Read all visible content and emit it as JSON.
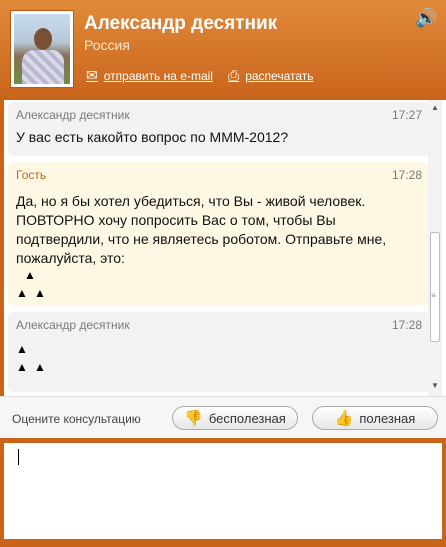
{
  "header": {
    "name": "Александр десятник",
    "country": "Россия",
    "email_label": "отправить на e-mail",
    "print_label": "распечатать",
    "icons": {
      "speaker": "speaker-icon",
      "email": "envelope-icon",
      "print": "printer-icon"
    }
  },
  "messages": [
    {
      "sender": "Александр десятник",
      "time": "17:27",
      "text": "У вас есть какойто вопрос по МММ-2012?"
    },
    {
      "sender": "Гость",
      "time": "17:28",
      "lines": [
        "Да, но я бы хотел убедиться, что Вы - живой человек.",
        "ПОВТОРНО хочу попросить Вас о том, чтобы Вы",
        "подтвердили, что не являетесь роботом. Отправьте мне,",
        "пожалуйста, это:"
      ]
    },
    {
      "sender": "Александр десятник",
      "time": "17:28"
    }
  ],
  "triangle_glyph": "▲",
  "rating": {
    "label": "Оцените консультацию",
    "useless_label": "бесполезная",
    "useful_label": "полезная"
  },
  "colors": {
    "accent": "#c9641b",
    "guest_bubble": "#fdf7e4",
    "agent_bubble": "#f2f2f2"
  }
}
